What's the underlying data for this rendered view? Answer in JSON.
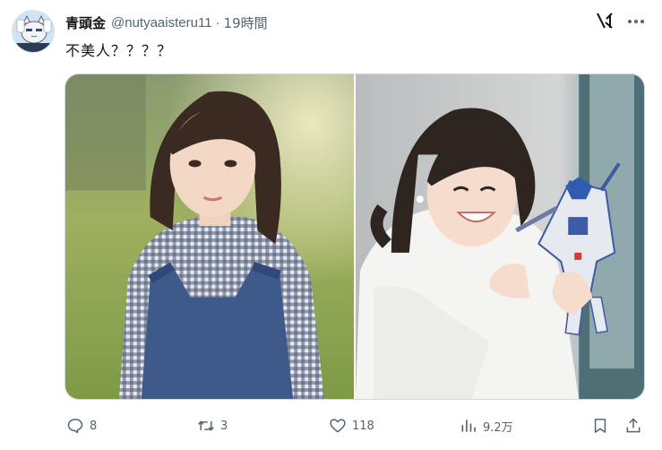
{
  "user": {
    "display_name": "青頭金",
    "handle": "@nutyaaisteru11",
    "separator": "·",
    "time": "19時間"
  },
  "tweet": {
    "text": "不美人？？？？"
  },
  "media": {
    "left_photo_icon": "photo-woman-outdoor",
    "right_photo_icon": "photo-woman-with-gundam-model"
  },
  "actions": {
    "reply_count": "8",
    "retweet_count": "3",
    "like_count": "118",
    "view_count": "9.2万"
  },
  "colors": {
    "text_primary": "#0f1419",
    "text_secondary": "#536471",
    "border": "#cfd9de"
  }
}
